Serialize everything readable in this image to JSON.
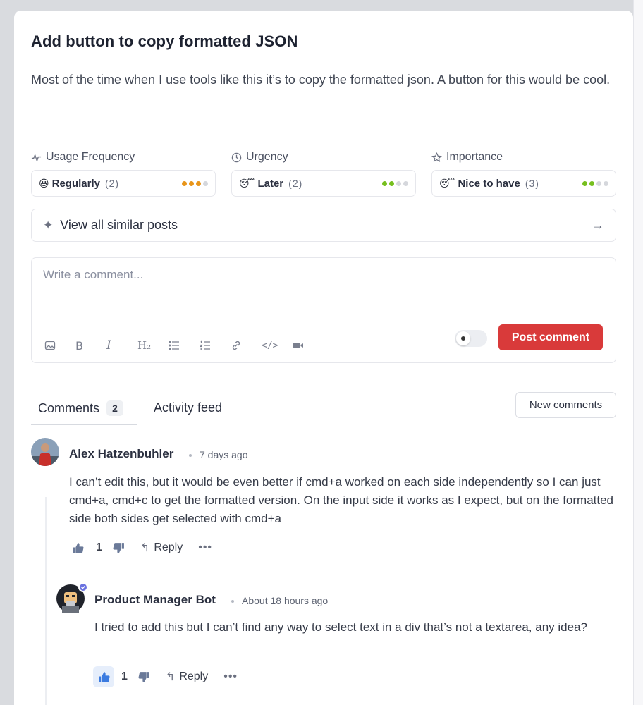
{
  "post": {
    "title": "Add button to copy formatted JSON",
    "description": "Most of the time when I use tools like this it’s to copy the formatted json. A button for this would be cool."
  },
  "meta": [
    {
      "label": "Usage Frequency",
      "icon": "activity-icon",
      "emoji": "😃",
      "value": "Regularly",
      "count": "(2)",
      "level": 3,
      "max": 4,
      "color": "#e8951a"
    },
    {
      "label": "Urgency",
      "icon": "clock-icon",
      "emoji": "😴",
      "value": "Later",
      "count": "(2)",
      "level": 2,
      "max": 4,
      "color": "#76bf1e"
    },
    {
      "label": "Importance",
      "icon": "star-icon",
      "emoji": "😴",
      "value": "Nice to have",
      "count": "(3)",
      "level": 2,
      "max": 4,
      "color": "#76bf1e"
    }
  ],
  "similar": {
    "label": "View all similar posts",
    "icon": "sparkle-icon",
    "arrow_icon": "arrow-right-icon"
  },
  "editor": {
    "placeholder": "Write a comment...",
    "toolbar": [
      "image-icon",
      "bold-icon",
      "italic-icon",
      "heading-icon",
      "bullet-list-icon",
      "numbered-list-icon",
      "link-icon",
      "code-icon",
      "video-icon"
    ],
    "post_label": "Post comment",
    "accent": "#d93a3a"
  },
  "tabs": {
    "comments_label": "Comments",
    "comments_count": "2",
    "activity_label": "Activity feed",
    "new_comments_label": "New comments"
  },
  "comments": [
    {
      "author": "Alex Hatzenbuhler",
      "time": "7 days ago",
      "body": "I can’t edit this, but it would be even better if cmd+a worked on each side independently so I can just cmd+a, cmd+c to get the formatted version. On the input side it works as I expect, but on the formatted side both sides get selected with cmd+a",
      "likes": "1",
      "reply_label": "Reply"
    },
    {
      "author": "Product Manager Bot",
      "time": "About 18 hours ago",
      "body": "I tried to add this but I can’t find any way to select text in a div that’s not a textarea, any idea?",
      "likes": "1",
      "reply_label": "Reply"
    }
  ]
}
